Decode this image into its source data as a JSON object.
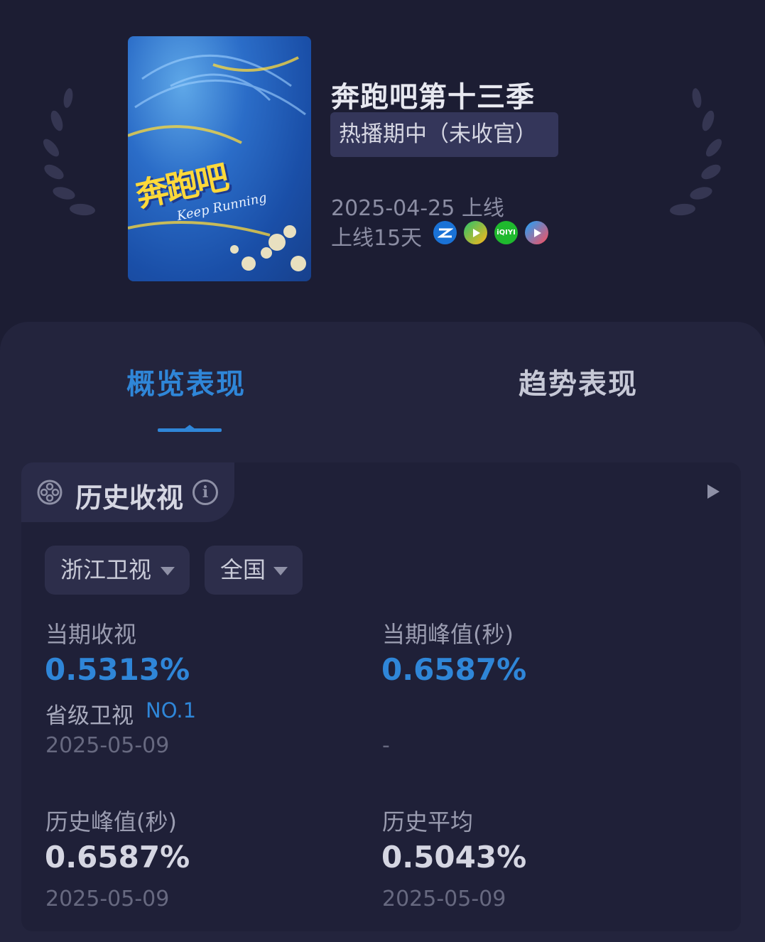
{
  "show": {
    "title": "奔跑吧第十三季",
    "status": "热播期中（未收官）",
    "release_date": "2025-04-25 上线",
    "days_online": "上线15天",
    "platforms": [
      "zhejiang-tv",
      "tencent-video",
      "iqiyi",
      "youku"
    ],
    "iqiyi_glyph": "iQIYI"
  },
  "poster": {
    "title": "奔跑吧",
    "subtitle": "Keep Running"
  },
  "tabs": [
    {
      "label": "概览表现",
      "active": true
    },
    {
      "label": "趋势表现",
      "active": false
    }
  ],
  "section": {
    "title": "历史收视",
    "info_glyph": "i"
  },
  "filters": {
    "channel": "浙江卫视",
    "region": "全国"
  },
  "metrics": {
    "current_rating": {
      "label": "当期收视",
      "value": "0.5313%",
      "rank_label": "省级卫视",
      "rank_value": "NO.1",
      "date": "2025-05-09"
    },
    "current_peak": {
      "label": "当期峰值(秒)",
      "value": "0.6587%",
      "date": "-"
    },
    "history_peak": {
      "label": "历史峰值(秒)",
      "value": "0.6587%",
      "date": "2025-05-09"
    },
    "history_avg": {
      "label": "历史平均",
      "value": "0.5043%",
      "date": "2025-05-09"
    }
  },
  "colors": {
    "background": "#1c1d33",
    "panel": "#23243d",
    "accent": "#2f86d8"
  }
}
